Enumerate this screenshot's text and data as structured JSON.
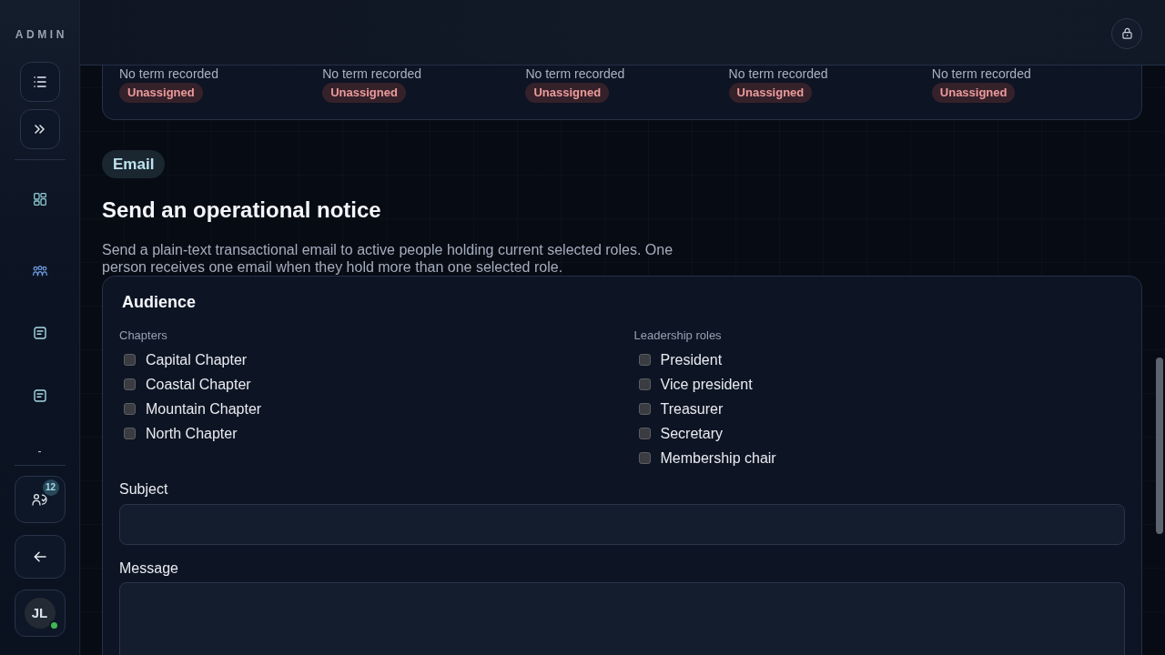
{
  "sidebar": {
    "brand": "ADMIN",
    "footer_text": "-",
    "members_badge": "12",
    "user": {
      "initials": "JL",
      "online": true
    }
  },
  "roles_summary": [
    {
      "term": "No term recorded",
      "status": "Unassigned"
    },
    {
      "term": "No term recorded",
      "status": "Unassigned"
    },
    {
      "term": "No term recorded",
      "status": "Unassigned"
    },
    {
      "term": "No term recorded",
      "status": "Unassigned"
    },
    {
      "term": "No term recorded",
      "status": "Unassigned"
    }
  ],
  "notice": {
    "tag": "Email",
    "title": "Send an operational notice",
    "description": "Send a plain-text transactional email to active people holding current selected roles. One person receives one email when they hold more than one selected role.",
    "form": {
      "title": "Audience",
      "groups": [
        {
          "label": "Chapters",
          "options": [
            {
              "label": "Capital Chapter",
              "checked": false
            },
            {
              "label": "Coastal Chapter",
              "checked": false
            },
            {
              "label": "Mountain Chapter",
              "checked": false
            },
            {
              "label": "North Chapter",
              "checked": false
            }
          ]
        },
        {
          "label": "Leadership roles",
          "options": [
            {
              "label": "President",
              "checked": false
            },
            {
              "label": "Vice president",
              "checked": false
            },
            {
              "label": "Treasurer",
              "checked": false
            },
            {
              "label": "Secretary",
              "checked": false
            },
            {
              "label": "Membership chair",
              "checked": false
            }
          ]
        }
      ],
      "fields": [
        {
          "label": "Subject",
          "kind": "input"
        },
        {
          "label": "Message",
          "kind": "textarea"
        }
      ]
    }
  }
}
